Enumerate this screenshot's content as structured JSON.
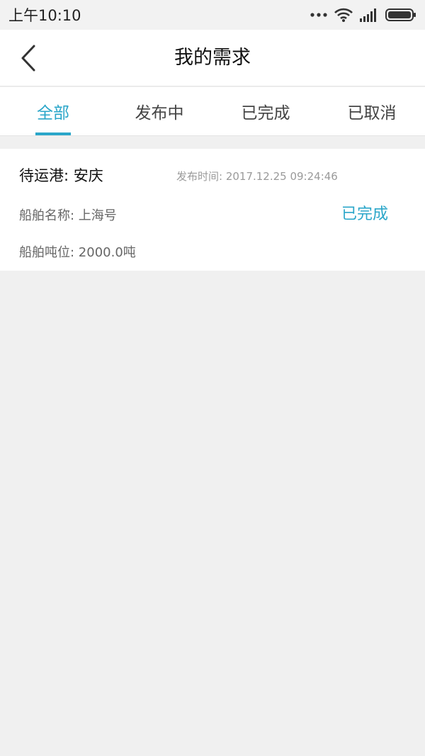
{
  "status_bar": {
    "time": "上午10:10"
  },
  "nav": {
    "title": "我的需求"
  },
  "tabs": [
    {
      "label": "全部",
      "active": true
    },
    {
      "label": "发布中",
      "active": false
    },
    {
      "label": "已完成",
      "active": false
    },
    {
      "label": "已取消",
      "active": false
    }
  ],
  "demands": [
    {
      "port_label": "待运港",
      "port_value": "安庆",
      "port_text": "待运港: 安庆",
      "publish_time_text": "发布时间: 2017.12.25 09:24:46",
      "ship_name_text": "船舶名称: 上海号",
      "tonnage_text": "船舶吨位: 2000.0吨",
      "status": "已完成"
    }
  ],
  "colors": {
    "accent": "#2aa6c9",
    "background": "#f0f0f0"
  },
  "icons": {
    "back": "chevron-left-icon",
    "more": "more-dots-icon",
    "wifi": "wifi-icon",
    "signal": "signal-icon",
    "battery": "battery-icon"
  }
}
